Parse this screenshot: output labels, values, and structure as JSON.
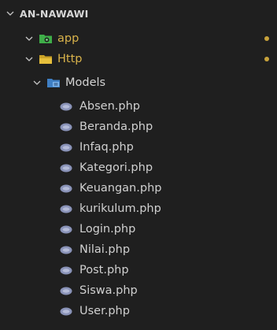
{
  "root": {
    "label": "AN-NAWAWI"
  },
  "folders": [
    {
      "label": "app",
      "color": "#d9b34b",
      "icon": "app-folder-icon",
      "modified": true
    },
    {
      "label": "Http",
      "color": "#d9b34b",
      "icon": "folder-icon",
      "modified": true
    },
    {
      "label": "Models",
      "color": "#d4d4d4",
      "icon": "models-folder-icon",
      "modified": false
    }
  ],
  "files": [
    {
      "label": "Absen.php",
      "icon": "php-icon"
    },
    {
      "label": "Beranda.php",
      "icon": "php-icon"
    },
    {
      "label": "Infaq.php",
      "icon": "php-icon"
    },
    {
      "label": "Kategori.php",
      "icon": "php-icon"
    },
    {
      "label": "Keuangan.php",
      "icon": "php-icon"
    },
    {
      "label": "kurikulum.php",
      "icon": "php-icon"
    },
    {
      "label": "Login.php",
      "icon": "php-icon"
    },
    {
      "label": "Nilai.php",
      "icon": "php-icon"
    },
    {
      "label": "Post.php",
      "icon": "php-icon"
    },
    {
      "label": "Siswa.php",
      "icon": "php-icon"
    },
    {
      "label": "User.php",
      "icon": "php-icon"
    }
  ],
  "colors": {
    "background": "#1f1f1f",
    "modified_dot": "#c7a23b",
    "app_icon": "#3fae49",
    "models_icon": "#5aa0e0",
    "php_icon": "#8a93b8"
  }
}
